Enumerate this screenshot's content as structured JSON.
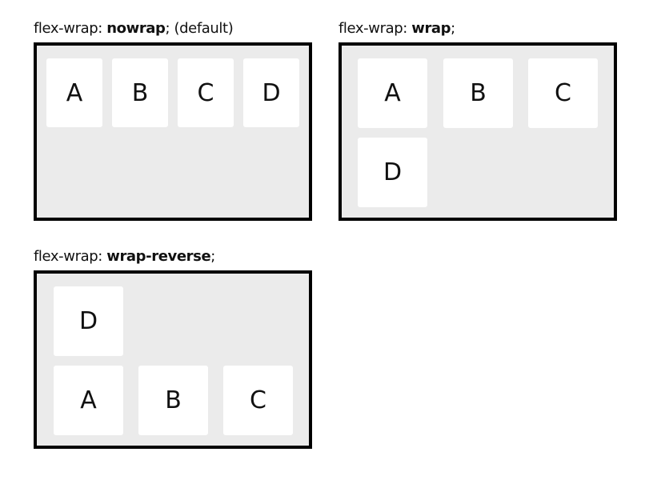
{
  "panels": [
    {
      "caption_prefix": "flex-wrap: ",
      "caption_value": "nowrap",
      "caption_suffix": "; (default)",
      "items": [
        "A",
        "B",
        "C",
        "D"
      ]
    },
    {
      "caption_prefix": "flex-wrap: ",
      "caption_value": "wrap",
      "caption_suffix": ";",
      "items": [
        "A",
        "B",
        "C",
        "D"
      ]
    },
    {
      "caption_prefix": "flex-wrap: ",
      "caption_value": "wrap-reverse",
      "caption_suffix": ";",
      "items": [
        "A",
        "B",
        "C",
        "D"
      ]
    }
  ],
  "colors": {
    "container_background": "#ebebeb",
    "container_border": "#000000",
    "item_background": "#ffffff",
    "text": "#111111"
  }
}
